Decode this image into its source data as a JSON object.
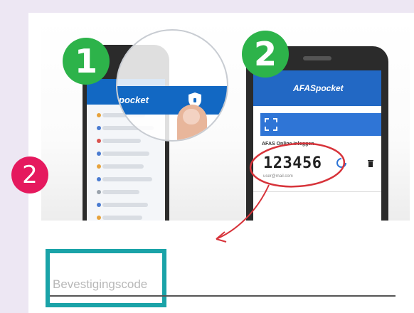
{
  "steps": {
    "step1_number": "1",
    "step2_number": "2"
  },
  "app": {
    "brand_small": "pocket",
    "brand_full": "AFASpocket",
    "code_caption": "AFAS Online inloggen",
    "code_value": "123456",
    "code_subtext": "user@mail.com"
  },
  "annotation": {
    "marker_number": "2"
  },
  "form": {
    "code_placeholder": "Bevestigingscode"
  },
  "colors": {
    "step_badge": "#2db34a",
    "marker": "#e5195e",
    "highlight_box": "#1aa3a8",
    "app_bar": "#1268c3",
    "code_circle": "#d7333a"
  }
}
